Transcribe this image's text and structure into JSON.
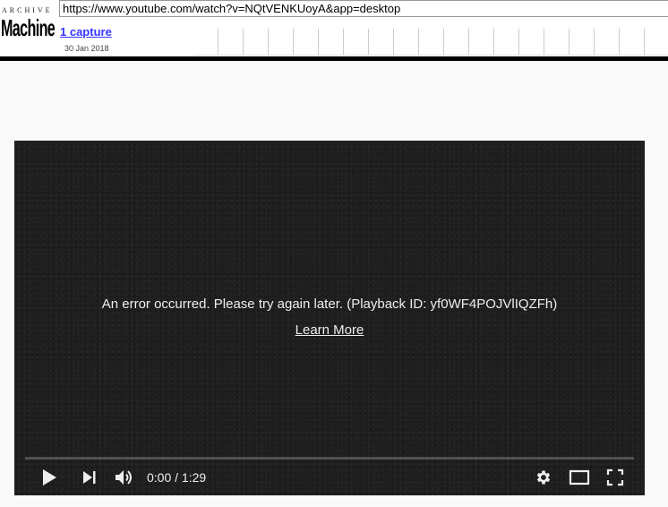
{
  "wayback": {
    "logo_top": "ARCHIVE",
    "logo_main": "Machine",
    "url": "https://www.youtube.com/watch?v=NQtVENKUoyA&app=desktop",
    "captures_label": "1 capture",
    "capture_date": "30 Jan 2018"
  },
  "player": {
    "error_text": "An error occurred. Please try again later. (Playback ID: yf0WF4POJVlIQZFh)",
    "learn_more_label": "Learn More",
    "current_time": "0:00",
    "duration": "1:29",
    "progress": 0
  },
  "icons": [
    "play-icon",
    "next-icon",
    "volume-icon",
    "settings-icon",
    "theater-icon",
    "fullscreen-icon"
  ]
}
